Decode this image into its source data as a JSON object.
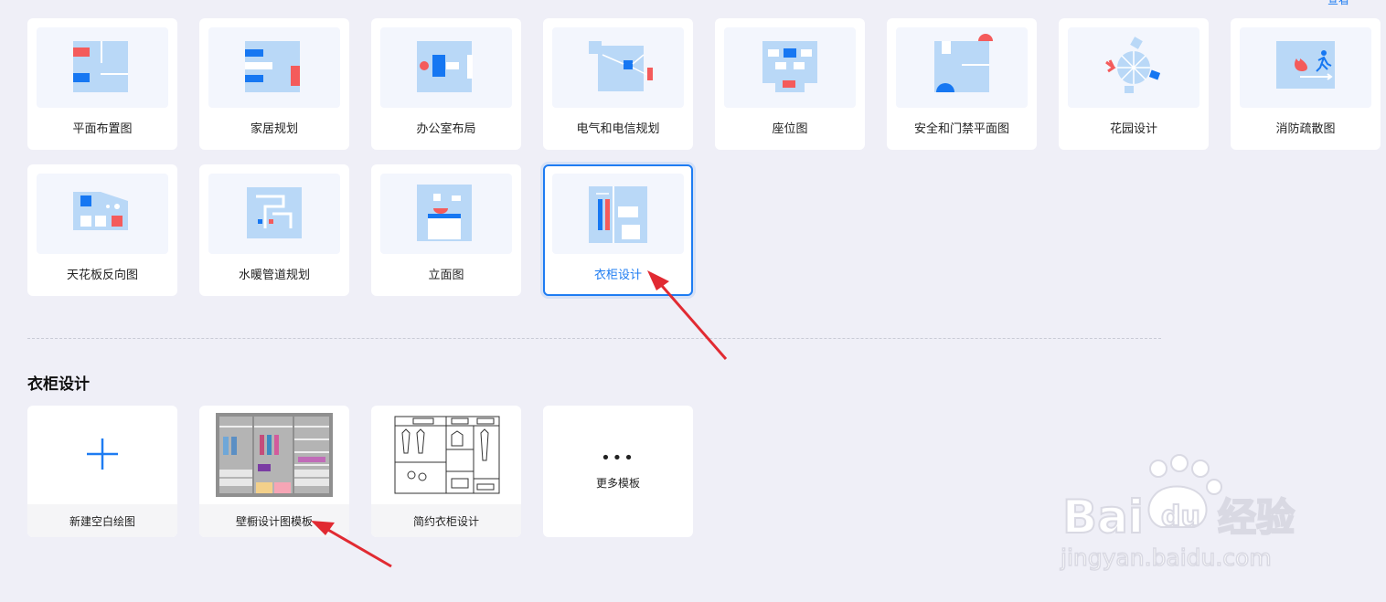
{
  "top_link": "查看",
  "categories": [
    {
      "label": "平面布置图"
    },
    {
      "label": "家居规划"
    },
    {
      "label": "办公室布局"
    },
    {
      "label": "电气和电信规划"
    },
    {
      "label": "座位图"
    },
    {
      "label": "安全和门禁平面图"
    },
    {
      "label": "花园设计"
    },
    {
      "label": "消防疏散图"
    },
    {
      "label": "天花板反向图"
    },
    {
      "label": "水暖管道规划"
    },
    {
      "label": "立面图"
    },
    {
      "label": "衣柜设计",
      "selected": true
    }
  ],
  "section": {
    "title": "衣柜设计",
    "templates": [
      {
        "label": "新建空白绘图"
      },
      {
        "label": "壁橱设计图模板"
      },
      {
        "label": "简约衣柜设计"
      }
    ],
    "more": {
      "dots": "•••",
      "label": "更多模板"
    }
  },
  "watermark": {
    "brand": "Bai",
    "brand2": "du",
    "cn": "经验",
    "url": "jingyan.baidu.com"
  },
  "colors": {
    "accent": "#1e7cf2",
    "thumb_fill": "#b9d8f7",
    "blue": "#1677f2",
    "red": "#f45b5b",
    "arrow": "#e12a32"
  }
}
